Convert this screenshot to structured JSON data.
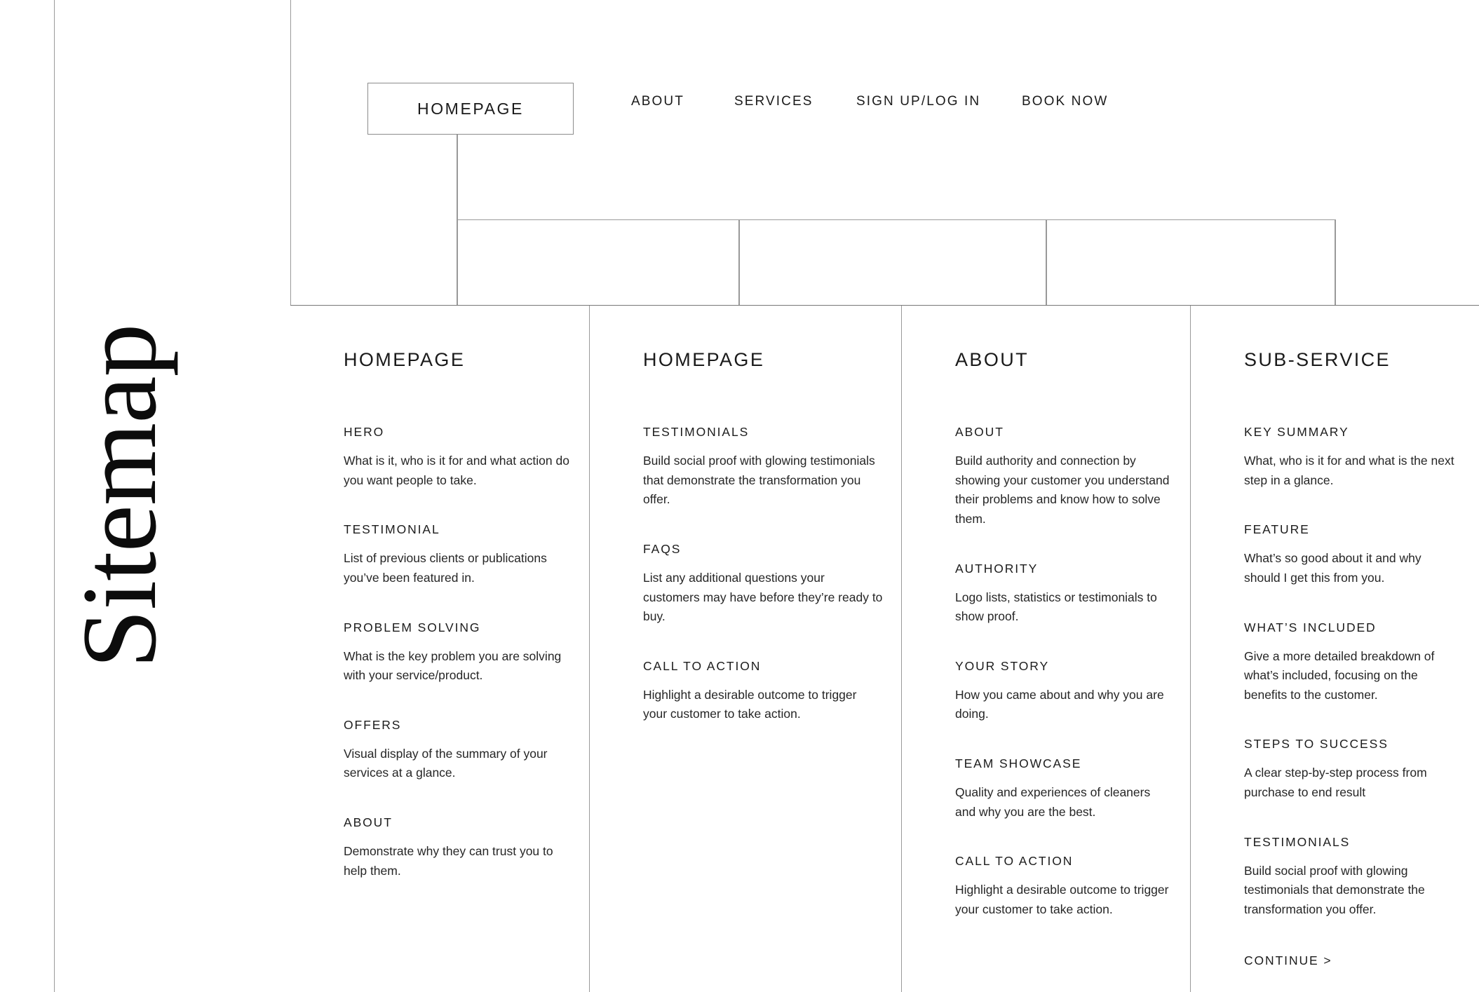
{
  "title": "Sitemap",
  "top_nav": {
    "primary": {
      "label": "HOMEPAGE"
    },
    "links": [
      {
        "label": "ABOUT"
      },
      {
        "label": "SERVICES"
      },
      {
        "label": "SIGN UP/LOG IN"
      },
      {
        "label": "BOOK NOW"
      }
    ]
  },
  "colors": {
    "line": "#9a9a9a",
    "line_strong": "#777777",
    "text": "#1a1a1a",
    "background": "#ffffff"
  },
  "columns": [
    {
      "heading": "HOMEPAGE",
      "sections": [
        {
          "title": "HERO",
          "body": "What is it, who is it for and what action do you want people to take."
        },
        {
          "title": "TESTIMONIAL",
          "body": "List of previous clients or publications you’ve been featured in."
        },
        {
          "title": "PROBLEM SOLVING",
          "body": "What is the key problem you are solving with your service/product."
        },
        {
          "title": "OFFERS",
          "body": "Visual display of the summary of your services at a glance."
        },
        {
          "title": "ABOUT",
          "body": "Demonstrate why they can trust you to help them."
        }
      ],
      "continue": null
    },
    {
      "heading": "HOMEPAGE",
      "sections": [
        {
          "title": "TESTIMONIALS",
          "body": "Build social proof with glowing testimonials that demonstrate the transformation you offer."
        },
        {
          "title": "FAQS",
          "body": "List any additional questions your customers may have before they’re ready to buy."
        },
        {
          "title": "CALL TO ACTION",
          "body": "Highlight a desirable outcome to trigger your customer to take action."
        }
      ],
      "continue": null
    },
    {
      "heading": "ABOUT",
      "sections": [
        {
          "title": "ABOUT",
          "body": "Build authority and connection by showing your customer you understand their problems and know how to solve them."
        },
        {
          "title": "AUTHORITY",
          "body": "Logo lists, statistics or testimonials to show proof."
        },
        {
          "title": "YOUR STORY",
          "body": "How you came about and why you are doing."
        },
        {
          "title": "TEAM SHOWCASE",
          "body": "Quality and experiences of cleaners and why you are the best."
        },
        {
          "title": "CALL TO ACTION",
          "body": "Highlight a desirable outcome to trigger your customer to take action."
        }
      ],
      "continue": null
    },
    {
      "heading": "SUB-SERVICE",
      "sections": [
        {
          "title": "KEY SUMMARY",
          "body": "What, who is it for and what is the next step in a glance."
        },
        {
          "title": "FEATURE",
          "body": "What’s so good about it and why should I get this from you."
        },
        {
          "title": "WHAT’S INCLUDED",
          "body": "Give a more detailed breakdown of what’s included, focusing on the benefits to the customer."
        },
        {
          "title": "STEPS TO SUCCESS",
          "body": "A clear step-by-step process from purchase to end result"
        },
        {
          "title": "TESTIMONIALS",
          "body": "Build social proof with glowing testimonials that demonstrate the transformation you offer."
        }
      ],
      "continue": "CONTINUE >"
    }
  ]
}
